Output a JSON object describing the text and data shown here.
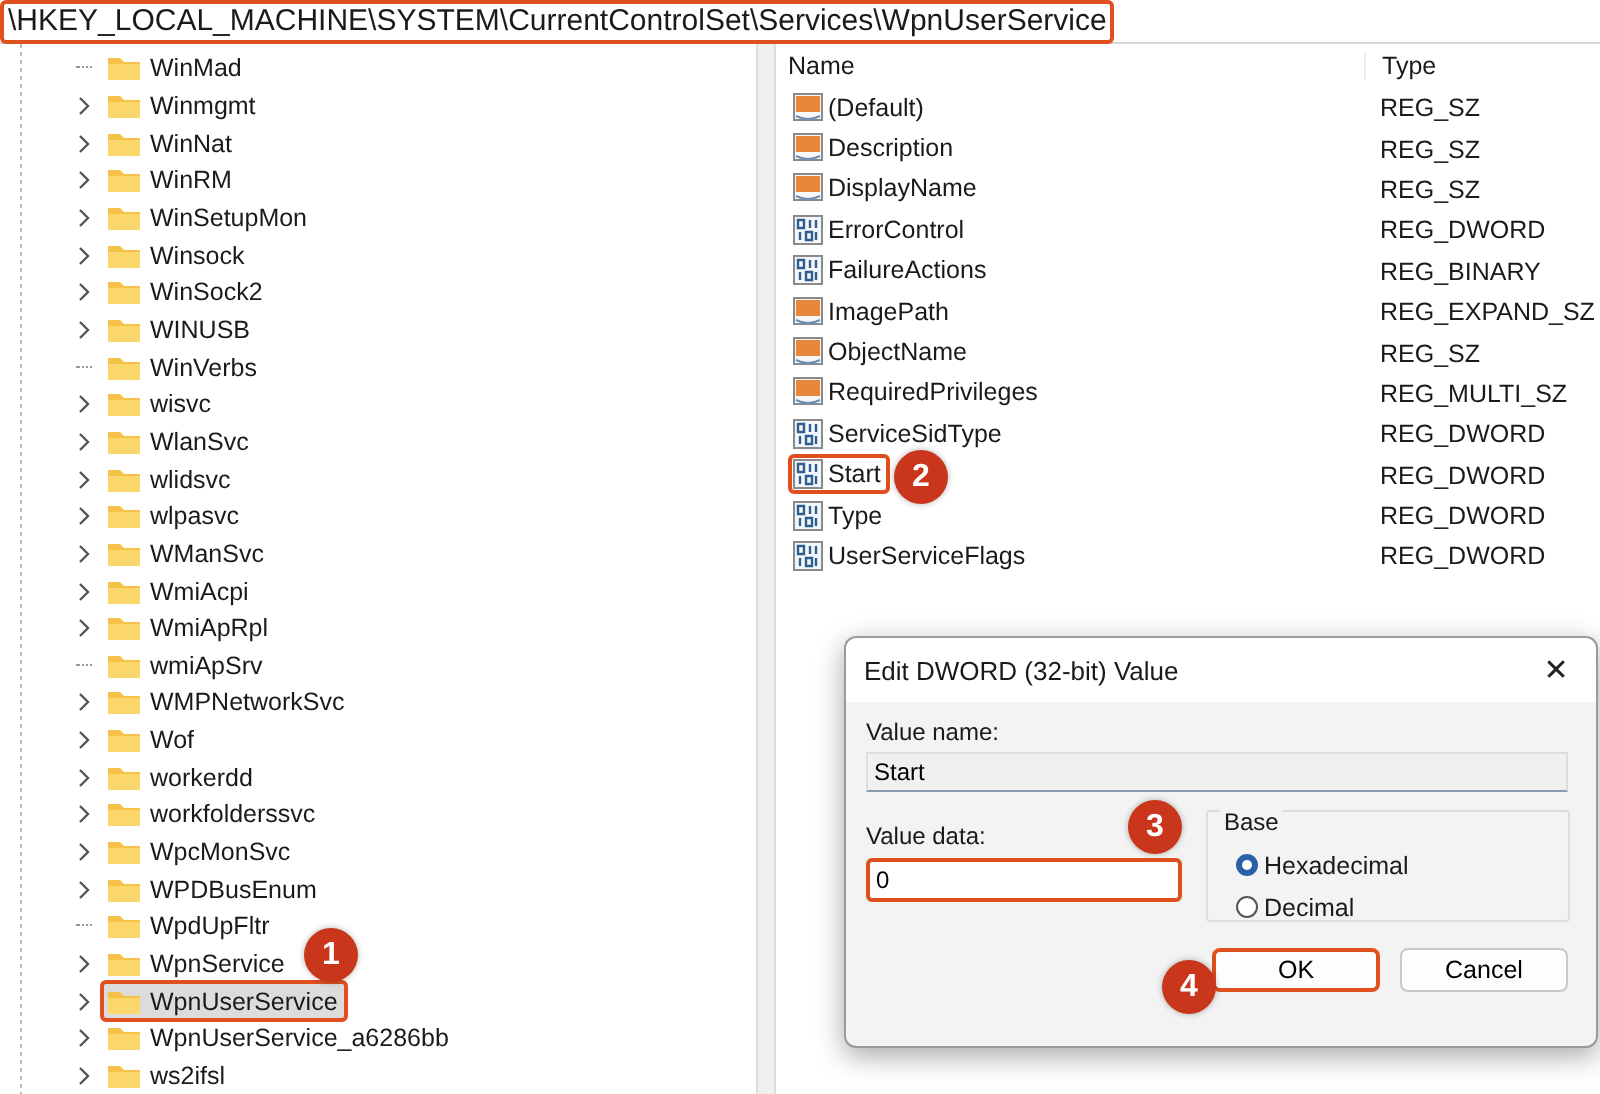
{
  "address_bar": {
    "path": "\\HKEY_LOCAL_MACHINE\\SYSTEM\\CurrentControlSet\\Services\\WpnUserService",
    "highlighted": true
  },
  "tree": {
    "items": [
      {
        "label": "WinMad",
        "expandable": false,
        "selected": false,
        "highlighted": false
      },
      {
        "label": "Winmgmt",
        "expandable": true,
        "selected": false,
        "highlighted": false
      },
      {
        "label": "WinNat",
        "expandable": true,
        "selected": false,
        "highlighted": false
      },
      {
        "label": "WinRM",
        "expandable": true,
        "selected": false,
        "highlighted": false
      },
      {
        "label": "WinSetupMon",
        "expandable": true,
        "selected": false,
        "highlighted": false
      },
      {
        "label": "Winsock",
        "expandable": true,
        "selected": false,
        "highlighted": false
      },
      {
        "label": "WinSock2",
        "expandable": true,
        "selected": false,
        "highlighted": false
      },
      {
        "label": "WINUSB",
        "expandable": true,
        "selected": false,
        "highlighted": false
      },
      {
        "label": "WinVerbs",
        "expandable": false,
        "selected": false,
        "highlighted": false
      },
      {
        "label": "wisvc",
        "expandable": true,
        "selected": false,
        "highlighted": false
      },
      {
        "label": "WlanSvc",
        "expandable": true,
        "selected": false,
        "highlighted": false
      },
      {
        "label": "wlidsvc",
        "expandable": true,
        "selected": false,
        "highlighted": false
      },
      {
        "label": "wlpasvc",
        "expandable": true,
        "selected": false,
        "highlighted": false
      },
      {
        "label": "WManSvc",
        "expandable": true,
        "selected": false,
        "highlighted": false
      },
      {
        "label": "WmiAcpi",
        "expandable": true,
        "selected": false,
        "highlighted": false
      },
      {
        "label": "WmiApRpl",
        "expandable": true,
        "selected": false,
        "highlighted": false
      },
      {
        "label": "wmiApSrv",
        "expandable": false,
        "selected": false,
        "highlighted": false
      },
      {
        "label": "WMPNetworkSvc",
        "expandable": true,
        "selected": false,
        "highlighted": false
      },
      {
        "label": "Wof",
        "expandable": true,
        "selected": false,
        "highlighted": false
      },
      {
        "label": "workerdd",
        "expandable": true,
        "selected": false,
        "highlighted": false
      },
      {
        "label": "workfolderssvc",
        "expandable": true,
        "selected": false,
        "highlighted": false
      },
      {
        "label": "WpcMonSvc",
        "expandable": true,
        "selected": false,
        "highlighted": false
      },
      {
        "label": "WPDBusEnum",
        "expandable": true,
        "selected": false,
        "highlighted": false
      },
      {
        "label": "WpdUpFltr",
        "expandable": false,
        "selected": false,
        "highlighted": false
      },
      {
        "label": "WpnService",
        "expandable": true,
        "selected": false,
        "highlighted": false
      },
      {
        "label": "WpnUserService",
        "expandable": true,
        "selected": true,
        "highlighted": true
      },
      {
        "label": "WpnUserService_a6286bb",
        "expandable": true,
        "selected": false,
        "highlighted": false
      },
      {
        "label": "ws2ifsl",
        "expandable": true,
        "selected": false,
        "highlighted": false
      }
    ]
  },
  "values": {
    "columns": [
      "Name",
      "Type"
    ],
    "rows": [
      {
        "name": "(Default)",
        "type": "REG_SZ",
        "kind": "string",
        "highlighted": false
      },
      {
        "name": "Description",
        "type": "REG_SZ",
        "kind": "string",
        "highlighted": false
      },
      {
        "name": "DisplayName",
        "type": "REG_SZ",
        "kind": "string",
        "highlighted": false
      },
      {
        "name": "ErrorControl",
        "type": "REG_DWORD",
        "kind": "binary",
        "highlighted": false
      },
      {
        "name": "FailureActions",
        "type": "REG_BINARY",
        "kind": "binary",
        "highlighted": false
      },
      {
        "name": "ImagePath",
        "type": "REG_EXPAND_SZ",
        "kind": "string",
        "highlighted": false
      },
      {
        "name": "ObjectName",
        "type": "REG_SZ",
        "kind": "string",
        "highlighted": false
      },
      {
        "name": "RequiredPrivileges",
        "type": "REG_MULTI_SZ",
        "kind": "string",
        "highlighted": false
      },
      {
        "name": "ServiceSidType",
        "type": "REG_DWORD",
        "kind": "binary",
        "highlighted": false
      },
      {
        "name": "Start",
        "type": "REG_DWORD",
        "kind": "binary",
        "highlighted": true
      },
      {
        "name": "Type",
        "type": "REG_DWORD",
        "kind": "binary",
        "highlighted": false
      },
      {
        "name": "UserServiceFlags",
        "type": "REG_DWORD",
        "kind": "binary",
        "highlighted": false
      }
    ]
  },
  "dialog": {
    "title": "Edit DWORD (32-bit) Value",
    "close": "✕",
    "value_name": {
      "label": "Value name:",
      "value": "Start"
    },
    "value_data": {
      "label": "Value data:",
      "value": "0",
      "highlighted": true
    },
    "base": {
      "label": "Base",
      "options": [
        {
          "label": "Hexadecimal",
          "selected": true
        },
        {
          "label": "Decimal",
          "selected": false
        }
      ]
    },
    "buttons": [
      {
        "label": "OK",
        "highlighted": true
      },
      {
        "label": "Cancel",
        "highlighted": false
      }
    ]
  },
  "callouts": [
    {
      "label": "1"
    },
    {
      "label": "2"
    },
    {
      "label": "3"
    },
    {
      "label": "4"
    }
  ]
}
